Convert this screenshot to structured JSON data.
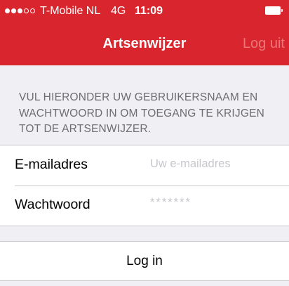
{
  "status_bar": {
    "carrier": "T-Mobile NL",
    "network": "4G",
    "time": "11:09",
    "signal_bars_filled": 3,
    "signal_bars_total": 5,
    "battery_icon": "battery-icon"
  },
  "nav_bar": {
    "title": "Artsenwijzer",
    "logout_label": "Log uit",
    "background_color": "#d9262e"
  },
  "instructions": "VUL HIERONDER UW GEBRUIKERSNAAM EN WACHTWOORD IN OM TOEGANG TE KRIJGEN TOT DE ARTSENWIJZER.",
  "form": {
    "email": {
      "label": "E-mailadres",
      "placeholder": "Uw e-mailadres"
    },
    "password": {
      "label": "Wachtwoord",
      "placeholder": "*******"
    }
  },
  "login_button": {
    "label": "Log in"
  }
}
